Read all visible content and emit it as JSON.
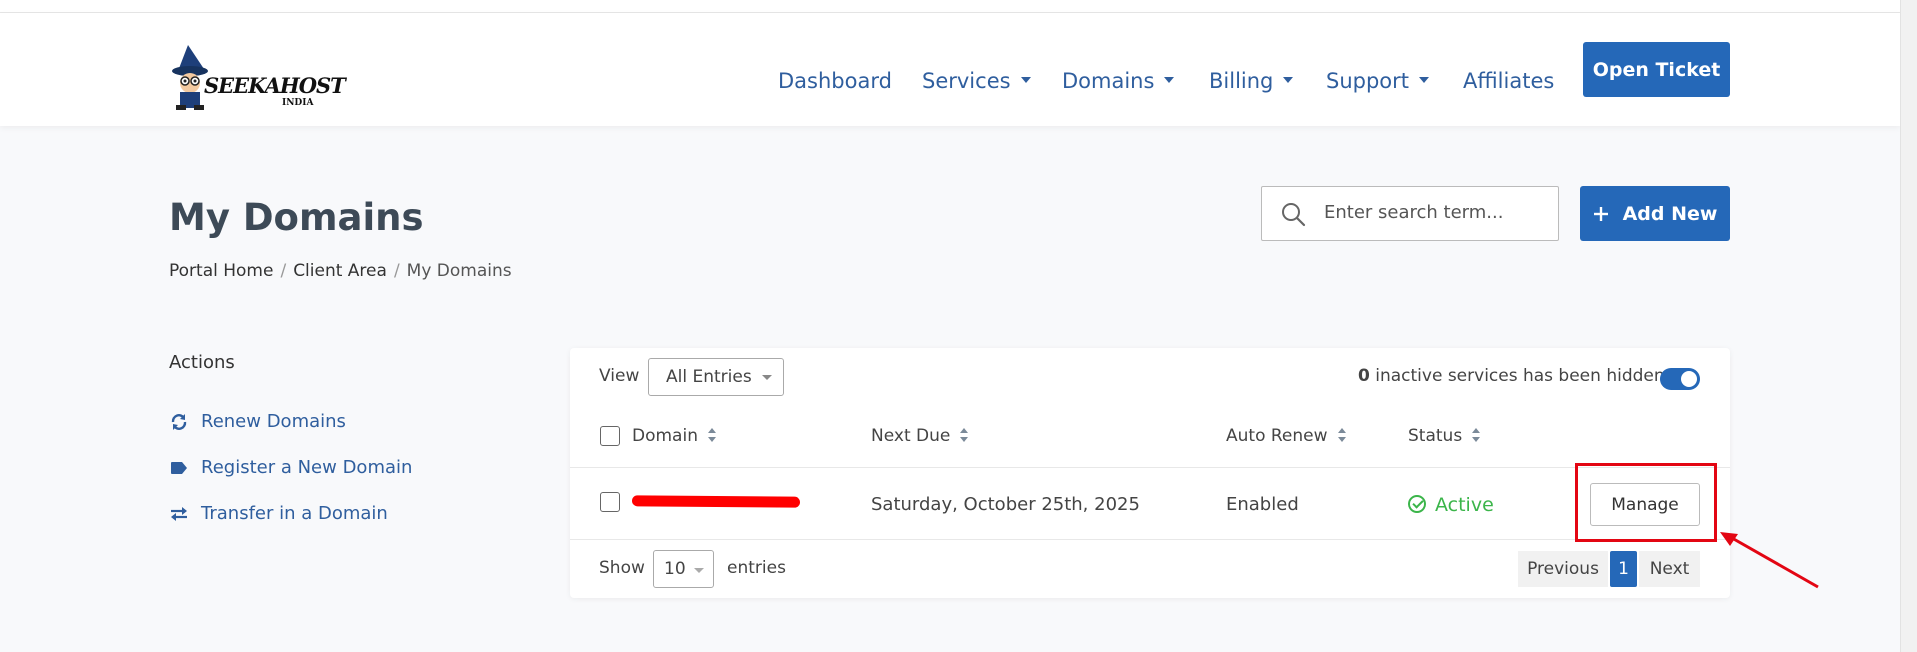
{
  "header": {
    "logo": {
      "text": "SEEKAHOST",
      "sub": "INDIA"
    },
    "nav": [
      {
        "label": "Dashboard",
        "dropdown": false
      },
      {
        "label": "Services",
        "dropdown": true
      },
      {
        "label": "Domains",
        "dropdown": true
      },
      {
        "label": "Billing",
        "dropdown": true
      },
      {
        "label": "Support",
        "dropdown": true
      },
      {
        "label": "Affiliates",
        "dropdown": false
      }
    ],
    "open_ticket_label": "Open Ticket"
  },
  "page": {
    "title": "My Domains",
    "breadcrumb": [
      "Portal Home",
      "Client Area",
      "My Domains"
    ],
    "search_placeholder": "Enter search term...",
    "add_new_label": "Add New"
  },
  "sidebar": {
    "title": "Actions",
    "items": [
      {
        "label": "Renew Domains",
        "icon": "renew-icon"
      },
      {
        "label": "Register a New Domain",
        "icon": "tag-icon"
      },
      {
        "label": "Transfer in a Domain",
        "icon": "transfer-icon"
      }
    ]
  },
  "table": {
    "view_label": "View",
    "view_selected": "All Entries",
    "hidden_count": "0",
    "hidden_text": "inactive services has been hidden",
    "columns": [
      "Domain",
      "Next Due",
      "Auto Renew",
      "Status"
    ],
    "rows": [
      {
        "domain": "[redacted]",
        "next_due": "Saturday, October 25th, 2025",
        "auto_renew": "Enabled",
        "status": "Active",
        "action": "Manage"
      }
    ],
    "show_label": "Show",
    "page_size": "10",
    "entries_label": "entries",
    "pagination": {
      "previous": "Previous",
      "current": "1",
      "next": "Next"
    }
  },
  "colors": {
    "primary": "#2568b8",
    "nav_text": "#2f5e9e",
    "active": "#3bb54a",
    "annotation": "#e30613"
  }
}
